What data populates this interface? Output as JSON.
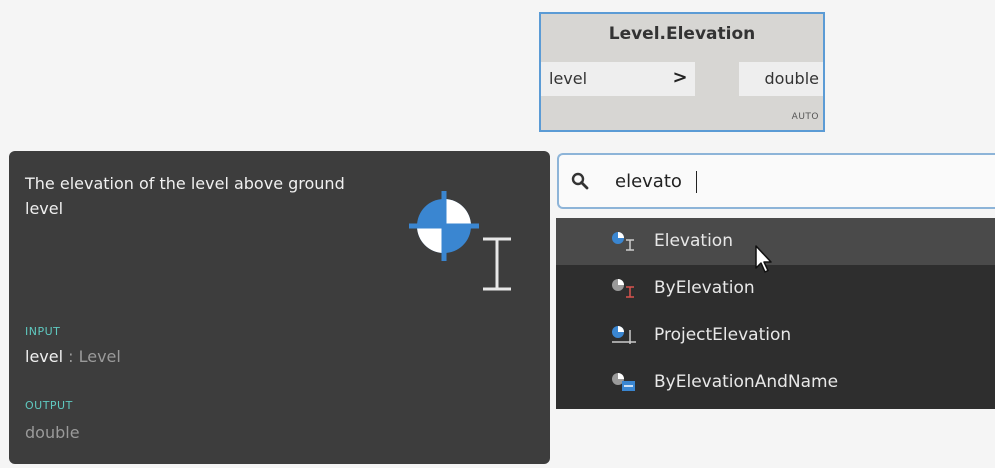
{
  "node": {
    "title": "Level.Elevation",
    "input_port": "level",
    "chevron": ">",
    "output_port": "double",
    "lacing": "AUTO"
  },
  "tooltip": {
    "description": "The elevation of the level above ground level",
    "input_label": "INPUT",
    "input_name": "level",
    "input_type": " : Level",
    "output_label": "OUTPUT",
    "output_type": "double",
    "icon": "level-elevation-icon"
  },
  "search": {
    "value": "elevato",
    "icon": "search-icon"
  },
  "results": [
    {
      "label": "Elevation",
      "icon": "elevation-query-icon",
      "selected": true
    },
    {
      "label": "ByElevation",
      "icon": "by-elevation-create-icon",
      "selected": false
    },
    {
      "label": "ProjectElevation",
      "icon": "project-elevation-icon",
      "selected": false
    },
    {
      "label": "ByElevationAndName",
      "icon": "by-elevation-and-name-icon",
      "selected": false
    }
  ],
  "colors": {
    "accent": "#3a86d1",
    "panel": "#3d3d3d",
    "section_label": "#5fc9c0",
    "results_bg": "#2e2e2e",
    "selected_row": "#4a4a4a"
  }
}
